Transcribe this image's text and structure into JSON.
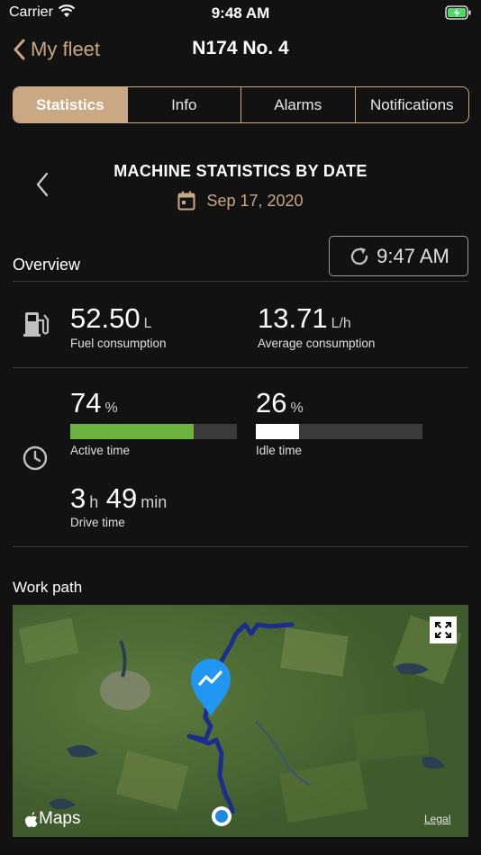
{
  "status_bar": {
    "carrier": "Carrier",
    "time": "9:48 AM"
  },
  "nav": {
    "back_label": "My fleet",
    "title": "N174 No. 4"
  },
  "tabs": [
    {
      "label": "Statistics",
      "active": true
    },
    {
      "label": "Info",
      "active": false
    },
    {
      "label": "Alarms",
      "active": false
    },
    {
      "label": "Notifications",
      "active": false
    }
  ],
  "stats_header": {
    "title": "MACHINE STATISTICS BY DATE",
    "date": "Sep 17, 2020"
  },
  "overview": {
    "label": "Overview",
    "refresh_time": "9:47 AM",
    "fuel_consumption": {
      "value": "52.50",
      "unit": "L",
      "label": "Fuel consumption"
    },
    "average_consumption": {
      "value": "13.71",
      "unit": "L/h",
      "label": "Average consumption"
    },
    "active_time": {
      "value": "74",
      "unit": "%",
      "label": "Active time",
      "fraction": 0.74
    },
    "idle_time": {
      "value": "26",
      "unit": "%",
      "label": "Idle time",
      "fraction": 0.26
    },
    "drive_time": {
      "hours": "3",
      "hours_unit": "h",
      "minutes": "49",
      "minutes_unit": "min",
      "label": "Drive time"
    }
  },
  "work_path": {
    "label": "Work path",
    "maps_label": "Maps",
    "legal_label": "Legal"
  },
  "colors": {
    "accent": "#c9a883",
    "active_bar": "#6cb33f",
    "idle_bar": "#ffffff",
    "path": "#1c2d8c",
    "pin": "#2196f3"
  }
}
